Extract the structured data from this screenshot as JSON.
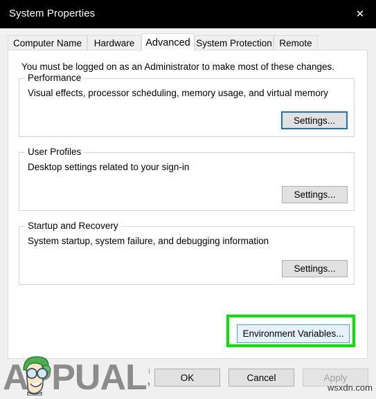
{
  "window": {
    "title": "System Properties",
    "close_icon": "close-icon",
    "titlebar_bg": "#000000",
    "titlebar_fg": "#ffffff"
  },
  "tabs": [
    {
      "label": "Computer Name",
      "selected": false
    },
    {
      "label": "Hardware",
      "selected": false
    },
    {
      "label": "Advanced",
      "selected": true
    },
    {
      "label": "System Protection",
      "selected": false
    },
    {
      "label": "Remote",
      "selected": false
    }
  ],
  "page": {
    "intro": "You must be logged on as an Administrator to make most of these changes.",
    "groups": [
      {
        "legend": "Performance",
        "description": "Visual effects, processor scheduling, memory usage, and virtual memory",
        "button_label": "Settings...",
        "button_state": "focused"
      },
      {
        "legend": "User Profiles",
        "description": "Desktop settings related to your sign-in",
        "button_label": "Settings...",
        "button_state": "normal"
      },
      {
        "legend": "Startup and Recovery",
        "description": "System startup, system failure, and debugging information",
        "button_label": "Settings...",
        "button_state": "normal"
      }
    ],
    "environment_variables": {
      "label": "Environment Variables...",
      "state": "hovered",
      "highlight_color": "#00e800"
    }
  },
  "footer": {
    "buttons": [
      {
        "label": "OK",
        "state": "normal"
      },
      {
        "label": "Cancel",
        "state": "normal"
      },
      {
        "label": "Apply",
        "state": "disabled"
      }
    ]
  },
  "watermarks": {
    "brand": "APPUALS",
    "brand_mark_color": "#8c8c8c",
    "site": "wsxdn.com"
  }
}
